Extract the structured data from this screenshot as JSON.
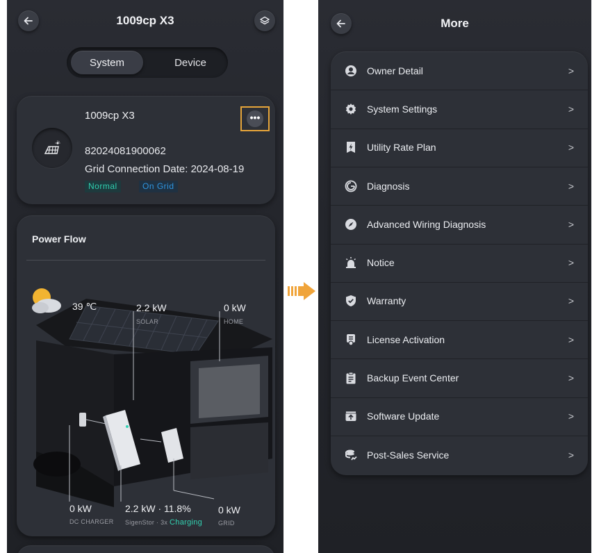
{
  "left": {
    "header": {
      "title": "1009cp X3"
    },
    "segments": {
      "system": "System",
      "device": "Device"
    },
    "system_card": {
      "name": "1009cp X3",
      "serial": "82024081900062",
      "grid_date": "Grid Connection Date: 2024-08-19",
      "status_normal": "Normal",
      "status_grid": "On Grid",
      "more_icon": "•••"
    },
    "power_flow": {
      "title": "Power Flow",
      "temperature": "39 ℃",
      "solar": {
        "value": "2.2 kW",
        "label": "SOLAR"
      },
      "home": {
        "value": "0 kW",
        "label": "HOME"
      },
      "dc_charger": {
        "value": "0 kW",
        "label": "DC CHARGER"
      },
      "battery": {
        "value": "2.2 kW · 11.8%",
        "label": "SigenStor · 3x",
        "state": "Charging"
      },
      "grid": {
        "value": "0 kW",
        "label": "GRID"
      }
    }
  },
  "right": {
    "header": {
      "title": "More"
    },
    "items": [
      {
        "label": "Owner Detail",
        "icon": "user-icon"
      },
      {
        "label": "System Settings",
        "icon": "gear-icon"
      },
      {
        "label": "Utility Rate Plan",
        "icon": "bolt-flag-icon"
      },
      {
        "label": "Diagnosis",
        "icon": "diagnosis-icon"
      },
      {
        "label": "Advanced Wiring Diagnosis",
        "icon": "compass-icon"
      },
      {
        "label": "Notice",
        "icon": "alarm-icon"
      },
      {
        "label": "Warranty",
        "icon": "shield-check-icon"
      },
      {
        "label": "License Activation",
        "icon": "license-icon"
      },
      {
        "label": "Backup Event Center",
        "icon": "clipboard-icon"
      },
      {
        "label": "Software Update",
        "icon": "upload-icon"
      },
      {
        "label": "Post-Sales Service",
        "icon": "service-icon"
      }
    ],
    "chevron": ">"
  },
  "colors": {
    "background": "#26282e",
    "card": "#2d3037",
    "accent_teal": "#2fd0b0",
    "accent_blue": "#2f95e0",
    "highlight_orange": "#e6a53a"
  }
}
